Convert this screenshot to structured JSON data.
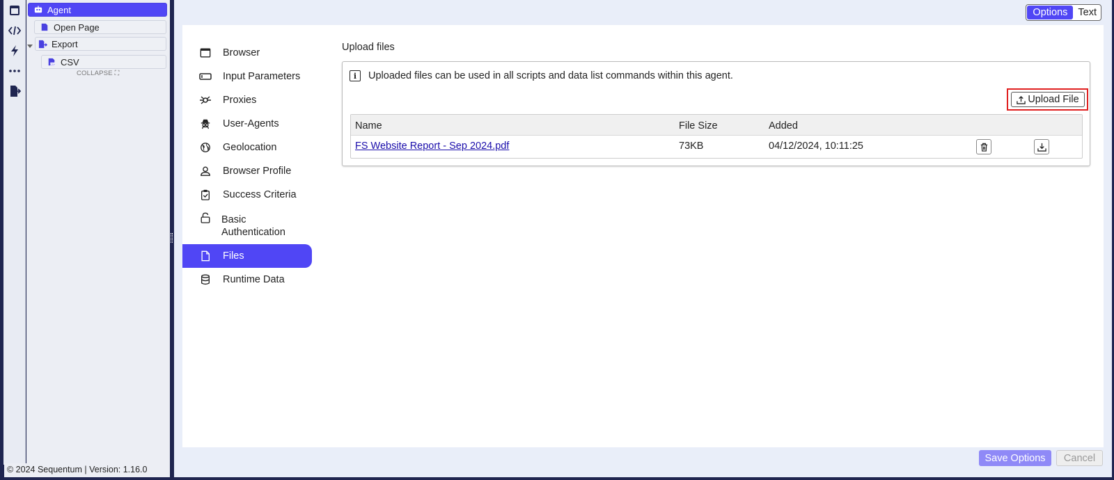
{
  "tree": {
    "items": [
      {
        "label": "Agent",
        "icon": "robot-icon"
      },
      {
        "label": "Open Page",
        "icon": "page-icon"
      },
      {
        "label": "Export",
        "icon": "export-icon"
      },
      {
        "label": "CSV",
        "icon": "csv-file-icon"
      }
    ],
    "collapse_label": "COLLAPSE ⛶"
  },
  "footer": {
    "version_text": "© 2024 Sequentum | Version: 1.16.0"
  },
  "view_toggle": {
    "options_label": "Options",
    "text_label": "Text",
    "selected": "Options"
  },
  "nav": {
    "items": [
      {
        "label": "Browser",
        "icon": "browser-window-icon"
      },
      {
        "label": "Input Parameters",
        "icon": "input-field-icon"
      },
      {
        "label": "Proxies",
        "icon": "network-icon"
      },
      {
        "label": "User-Agents",
        "icon": "agent-spy-icon"
      },
      {
        "label": "Geolocation",
        "icon": "globe-icon"
      },
      {
        "label": "Browser Profile",
        "icon": "user-profile-icon"
      },
      {
        "label": "Success Criteria",
        "icon": "clipboard-check-icon"
      },
      {
        "label": "Basic\nAuthentication",
        "icon": "unlock-icon"
      },
      {
        "label": "Files",
        "icon": "file-icon"
      },
      {
        "label": "Runtime Data",
        "icon": "database-icon"
      }
    ],
    "active": "Files"
  },
  "upload": {
    "title": "Upload files",
    "info_text": "Uploaded files can be used in all scripts and data list commands within this agent.",
    "upload_button_label": "Upload File",
    "table": {
      "headers": [
        "Name",
        "File Size",
        "Added"
      ],
      "rows": [
        {
          "name": "FS Website Report - Sep 2024.pdf",
          "size": "73KB",
          "added": "04/12/2024, 10:11:25"
        }
      ]
    }
  },
  "actions": {
    "save_label": "Save Options",
    "cancel_label": "Cancel"
  },
  "colors": {
    "accent": "#5046f5",
    "frame": "#1f2550",
    "highlight": "#e02020"
  }
}
